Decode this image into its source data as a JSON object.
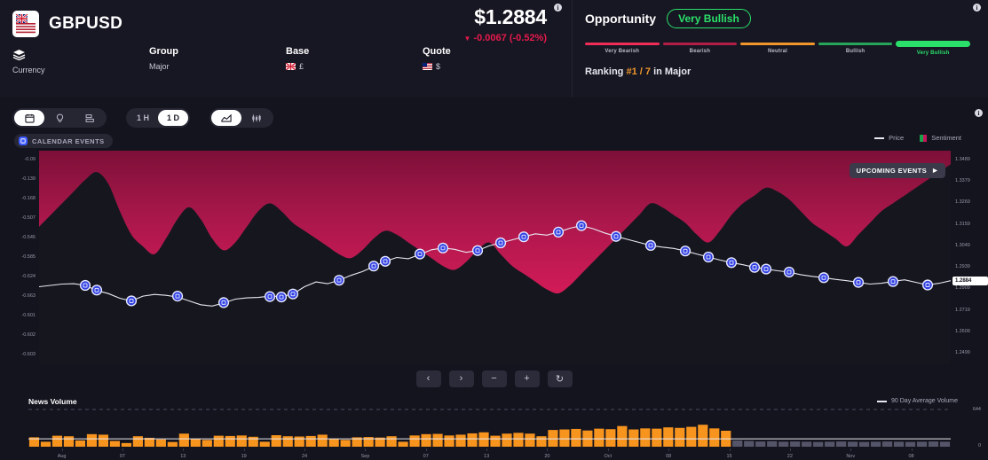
{
  "header": {
    "symbol": "GBPUSD",
    "flag_icon": "uk-us-flag-icon",
    "price": "$1.2884",
    "change": "-0.0067 (-0.52%)",
    "change_caret": "▼",
    "info_glyph": "i",
    "meta": [
      {
        "icon": "currency-stack-icon",
        "title": "",
        "sub": "Currency"
      },
      {
        "icon": "",
        "title": "Group",
        "sub": "Major"
      },
      {
        "icon": "",
        "title": "Base",
        "sub": "£",
        "flag": "gb"
      },
      {
        "icon": "",
        "title": "Quote",
        "sub": "$",
        "flag": "us"
      }
    ]
  },
  "opportunity": {
    "label": "Opportunity",
    "badge": "Very Bullish",
    "badge_color": "#2ae06a",
    "segments": [
      {
        "caption": "Very Bearish",
        "color": "#ef2d56",
        "active": false
      },
      {
        "caption": "Bearish",
        "color": "#b21e45",
        "active": false
      },
      {
        "caption": "Neutral",
        "color": "#f0962a",
        "active": false
      },
      {
        "caption": "Bullish",
        "color": "#27a65a",
        "active": false
      },
      {
        "caption": "Very Bullish",
        "color": "#2ae06a",
        "active": true
      }
    ],
    "ranking_label": "Ranking",
    "ranking_value": "#1 / 7",
    "ranking_suffix": "in Major"
  },
  "toolbar": {
    "view_group": [
      {
        "icon": "calendar-icon",
        "label": "",
        "active": true
      },
      {
        "icon": "bulb-icon",
        "label": "",
        "active": false
      },
      {
        "icon": "bar-list-icon",
        "label": "",
        "active": false
      }
    ],
    "timeframe_group": [
      {
        "label": "1 H",
        "active": false
      },
      {
        "label": "1 D",
        "active": true
      }
    ],
    "chart_type_group": [
      {
        "icon": "area-chart-icon",
        "label": "",
        "active": true
      },
      {
        "icon": "candlestick-icon",
        "label": "",
        "active": false
      }
    ],
    "info_glyph": "i"
  },
  "chips": [
    {
      "label": "CALENDAR EVENTS",
      "icon": "calendar-square-icon",
      "color": "#3d5afe"
    }
  ],
  "chart_legend": [
    {
      "label": "Price",
      "type": "line",
      "color": "#e9e9f2"
    },
    {
      "label": "Sentiment",
      "type": "swatch",
      "color": "#c2185b"
    }
  ],
  "chart_overlay": {
    "upcoming_events": "UPCOMING EVENTS",
    "upcoming_icon": "play-icon",
    "current_price_tag": "1.2884"
  },
  "nav_buttons": [
    {
      "icon": "chevron-left-icon",
      "label": "‹"
    },
    {
      "icon": "chevron-right-icon",
      "label": "›"
    },
    {
      "icon": "zoom-out-icon",
      "label": "−"
    },
    {
      "icon": "zoom-in-icon",
      "label": "+"
    },
    {
      "icon": "reset-icon",
      "label": "↻"
    }
  ],
  "news": {
    "title": "News Volume",
    "legend_label": "90 Day Average Volume",
    "y_labels": [
      "644",
      "0"
    ]
  },
  "chart_data": {
    "type": "area",
    "title": "GBPUSD Price with Sentiment Band",
    "xlabel": "",
    "ylabel_left": "Sentiment",
    "ylabel_right": "Price",
    "grid": false,
    "legend_position": "top-right",
    "y_left_ticks": [
      "-0.09",
      "-0.139",
      "-0.168",
      "-0.507",
      "-0.545",
      "-0.585",
      "-0.624",
      "-0.663",
      "-0.601",
      "-0.602",
      "-0.603"
    ],
    "y_right_ticks": [
      "1.3489",
      "1.3379",
      "1.3269",
      "1.3159",
      "1.3049",
      "1.2939",
      "1.2909",
      "1.2719",
      "1.2609",
      "1.2499"
    ],
    "y_right_range": [
      1.2499,
      1.3489
    ],
    "x_ticks": [
      "Aug",
      "07",
      "13",
      "19",
      "24",
      "Sep",
      "07",
      "13",
      "20",
      "Oct",
      "08",
      "15",
      "22",
      "Nov",
      "08"
    ],
    "series": [
      {
        "name": "Price",
        "type": "line",
        "color": "#e9e9f2",
        "values": [
          1.2856,
          1.2862,
          1.2868,
          1.287,
          1.2862,
          1.2838,
          1.2824,
          1.2802,
          1.279,
          1.2812,
          1.282,
          1.2816,
          1.2808,
          1.279,
          1.2772,
          1.2766,
          1.278,
          1.2798,
          1.2804,
          1.2806,
          1.2812,
          1.281,
          1.2822,
          1.2856,
          1.2878,
          1.287,
          1.2886,
          1.2908,
          1.2926,
          1.295,
          1.2974,
          1.2992,
          1.2986,
          1.3006,
          1.3028,
          1.3036,
          1.303,
          1.3016,
          1.3024,
          1.3046,
          1.306,
          1.3074,
          1.3088,
          1.3102,
          1.3096,
          1.311,
          1.3128,
          1.314,
          1.3126,
          1.3106,
          1.309,
          1.3076,
          1.3062,
          1.3048,
          1.304,
          1.3034,
          1.3022,
          1.3008,
          1.2994,
          1.298,
          1.2968,
          1.2958,
          1.2946,
          1.2938,
          1.293,
          1.2924,
          1.2912,
          1.2904,
          1.2898,
          1.289,
          1.2884,
          1.2876,
          1.2868,
          1.2872,
          1.288,
          1.2888,
          1.2876,
          1.2864,
          1.2872,
          1.2884
        ]
      },
      {
        "name": "Sentiment",
        "type": "area",
        "color": "#c2185b",
        "values": [
          0.62,
          0.68,
          0.74,
          0.8,
          0.86,
          0.9,
          0.84,
          0.7,
          0.58,
          0.52,
          0.48,
          0.56,
          0.66,
          0.72,
          0.66,
          0.56,
          0.5,
          0.54,
          0.62,
          0.7,
          0.74,
          0.7,
          0.64,
          0.6,
          0.56,
          0.52,
          0.48,
          0.46,
          0.5,
          0.56,
          0.6,
          0.58,
          0.54,
          0.5,
          0.46,
          0.42,
          0.4,
          0.44,
          0.5,
          0.54,
          0.48,
          0.42,
          0.38,
          0.34,
          0.3,
          0.28,
          0.32,
          0.38,
          0.44,
          0.5,
          0.56,
          0.62,
          0.68,
          0.74,
          0.72,
          0.68,
          0.64,
          0.58,
          0.54,
          0.6,
          0.68,
          0.74,
          0.78,
          0.82,
          0.8,
          0.76,
          0.7,
          0.64,
          0.6,
          0.56,
          0.52,
          0.58,
          0.64,
          0.7,
          0.74,
          0.78,
          0.82,
          0.86,
          0.9,
          0.94
        ]
      }
    ],
    "event_markers": [
      {
        "i": 4,
        "price": 1.2862
      },
      {
        "i": 5,
        "price": 1.284
      },
      {
        "i": 8,
        "price": 1.279
      },
      {
        "i": 12,
        "price": 1.2812
      },
      {
        "i": 16,
        "price": 1.2782
      },
      {
        "i": 20,
        "price": 1.281
      },
      {
        "i": 21,
        "price": 1.2808
      },
      {
        "i": 22,
        "price": 1.2822
      },
      {
        "i": 26,
        "price": 1.2886
      },
      {
        "i": 29,
        "price": 1.2952
      },
      {
        "i": 30,
        "price": 1.2974
      },
      {
        "i": 33,
        "price": 1.3008
      },
      {
        "i": 35,
        "price": 1.3036
      },
      {
        "i": 38,
        "price": 1.3024
      },
      {
        "i": 40,
        "price": 1.306
      },
      {
        "i": 42,
        "price": 1.3088
      },
      {
        "i": 45,
        "price": 1.311
      },
      {
        "i": 47,
        "price": 1.314
      },
      {
        "i": 50,
        "price": 1.309
      },
      {
        "i": 53,
        "price": 1.3048
      },
      {
        "i": 56,
        "price": 1.3022
      },
      {
        "i": 58,
        "price": 1.2994
      },
      {
        "i": 60,
        "price": 1.2968
      },
      {
        "i": 62,
        "price": 1.2946
      },
      {
        "i": 63,
        "price": 1.2938
      },
      {
        "i": 65,
        "price": 1.2924
      },
      {
        "i": 68,
        "price": 1.2898
      },
      {
        "i": 71,
        "price": 1.2876
      },
      {
        "i": 74,
        "price": 1.288
      },
      {
        "i": 77,
        "price": 1.2864
      }
    ]
  },
  "news_chart_data": {
    "type": "bar",
    "title": "News Volume",
    "ylabel": "",
    "ymax": 644,
    "legend": [
      "90 Day Average Volume"
    ],
    "average_line": 150,
    "bar_color_past": "#f7941e",
    "bar_color_future": "#55556a",
    "values": [
      180,
      95,
      210,
      200,
      120,
      240,
      230,
      110,
      70,
      200,
      170,
      140,
      90,
      250,
      150,
      130,
      210,
      205,
      215,
      190,
      95,
      220,
      200,
      195,
      205,
      230,
      150,
      130,
      180,
      185,
      175,
      200,
      95,
      215,
      240,
      245,
      215,
      230,
      255,
      275,
      210,
      250,
      265,
      250,
      200,
      320,
      330,
      340,
      310,
      345,
      335,
      395,
      330,
      350,
      345,
      370,
      360,
      380,
      420,
      350,
      305,
      120,
      110,
      100,
      105,
      95,
      100,
      95,
      90,
      95,
      100,
      95,
      90,
      95,
      100,
      95,
      90,
      95,
      100,
      95
    ],
    "future_start_index": 61
  }
}
